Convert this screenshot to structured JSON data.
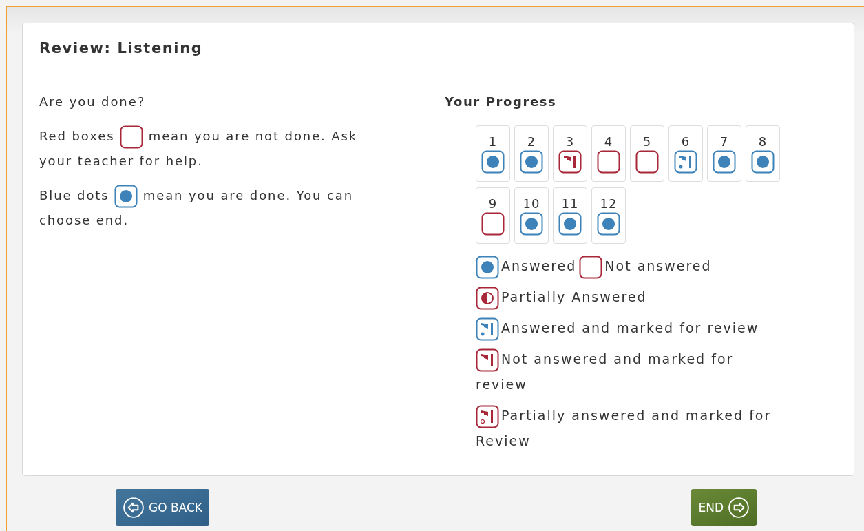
{
  "title": "Review: Listening",
  "intro": "Are you done?",
  "hints": [
    {
      "before": "Red boxes",
      "kind": "not_answered",
      "after": "mean you are not done. Ask your teacher for help."
    },
    {
      "before": "Blue dots",
      "kind": "answered",
      "after": "mean you are done. You can choose end."
    }
  ],
  "progress": {
    "title": "Your Progress",
    "questions": [
      {
        "number": "1",
        "kind": "answered"
      },
      {
        "number": "2",
        "kind": "answered"
      },
      {
        "number": "3",
        "kind": "not_answered_review"
      },
      {
        "number": "4",
        "kind": "not_answered"
      },
      {
        "number": "5",
        "kind": "not_answered"
      },
      {
        "number": "6",
        "kind": "answered_review"
      },
      {
        "number": "7",
        "kind": "answered"
      },
      {
        "number": "8",
        "kind": "answered"
      },
      {
        "number": "9",
        "kind": "not_answered"
      },
      {
        "number": "10",
        "kind": "answered"
      },
      {
        "number": "11",
        "kind": "answered"
      },
      {
        "number": "12",
        "kind": "answered"
      }
    ],
    "legend": [
      [
        {
          "kind": "answered",
          "label": "Answered"
        },
        {
          "kind": "not_answered",
          "label": "Not answered"
        }
      ],
      [
        {
          "kind": "partial",
          "label": "Partially Answered"
        }
      ],
      [
        {
          "kind": "answered_review",
          "label": "Answered and marked for review"
        }
      ],
      [
        {
          "kind": "not_answered_review",
          "label": "Not answered and marked for review"
        }
      ],
      [
        {
          "kind": "partial_review",
          "label": "Partially answered and marked for Review"
        }
      ]
    ]
  },
  "buttons": [
    {
      "kind": "back",
      "label": "GO BACK"
    },
    {
      "kind": "end",
      "label": "END"
    }
  ]
}
